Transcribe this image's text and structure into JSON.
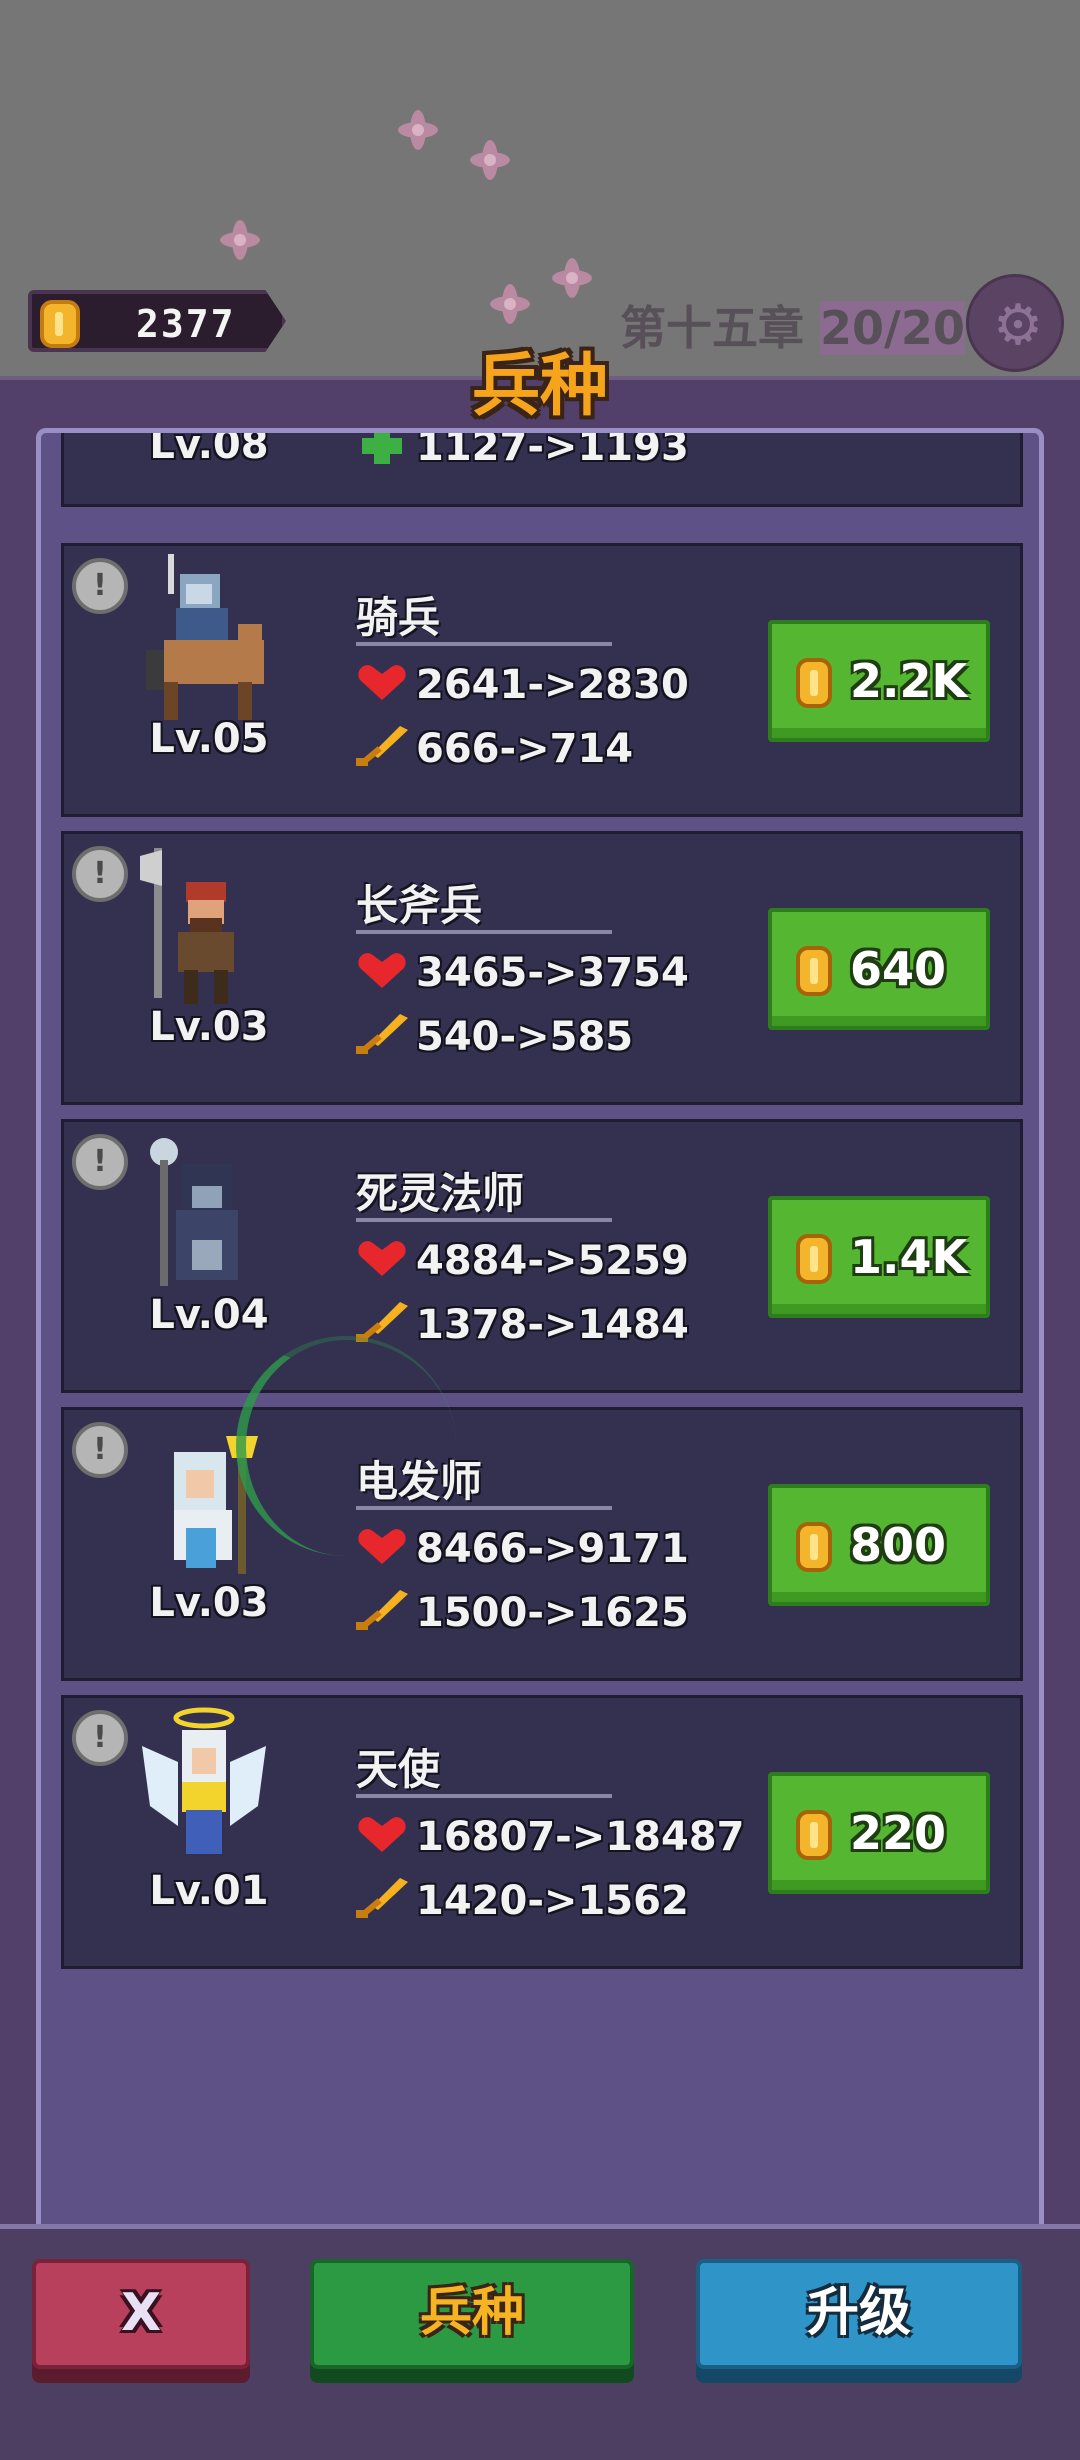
{
  "hud": {
    "coins": "2377",
    "chapter_prefix": "第十五章",
    "chapter_progress": "20/20"
  },
  "panel": {
    "title": "兵种"
  },
  "partial_unit": {
    "level": "Lv.08",
    "stat": "1127->1193"
  },
  "units": [
    {
      "name": "骑兵",
      "level": "Lv.05",
      "hp": "2641->2830",
      "atk": "666->714",
      "price": "2.2K"
    },
    {
      "name": "长斧兵",
      "level": "Lv.03",
      "hp": "3465->3754",
      "atk": "540->585",
      "price": "640"
    },
    {
      "name": "死灵法师",
      "level": "Lv.04",
      "hp": "4884->5259",
      "atk": "1378->1484",
      "price": "1.4K"
    },
    {
      "name": "电发师",
      "level": "Lv.03",
      "hp": "8466->9171",
      "atk": "1500->1625",
      "price": "800"
    },
    {
      "name": "天使",
      "level": "Lv.01",
      "hp": "16807->18487",
      "atk": "1420->1562",
      "price": "220"
    }
  ],
  "bottom": {
    "close_label": "X",
    "troops_label": "兵种",
    "upgrade_label": "升级"
  },
  "colors": {
    "price_button": "#55b731",
    "title": "#f6a41c",
    "close_button": "#b8405c",
    "troops_button": "#2b9a42",
    "upgrade_button": "#2f95c8"
  }
}
